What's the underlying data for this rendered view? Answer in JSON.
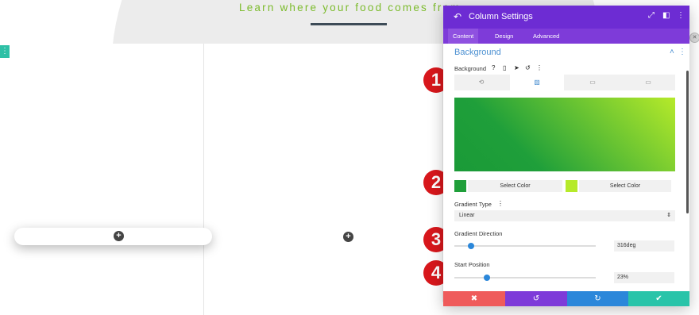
{
  "page": {
    "headline": "Learn where your food comes from",
    "side_handle_icon": "⋮",
    "plus_glyph": "+"
  },
  "badges": [
    "1",
    "2",
    "3",
    "4"
  ],
  "panel": {
    "back_icon": "↶",
    "title": "Column Settings",
    "header_icons": [
      "⤢",
      "◧",
      "⋮"
    ],
    "tabs": [
      "Content",
      "Design",
      "Advanced"
    ],
    "active_tab": "Content",
    "section_title": "Background",
    "section_collapse_icon": "˄",
    "section_menu_icon": "⋮",
    "background_label": "Background",
    "background_icons": [
      "?",
      "▯",
      "➤",
      "↺",
      "⋮"
    ],
    "bg_type_tabs": [
      "⟲",
      "▨",
      "▭",
      "▭"
    ],
    "bg_type_active": 1,
    "gradient": {
      "start_color": "#1f9f3a",
      "end_color": "#b6ea2a",
      "direction": "316deg"
    },
    "color1": {
      "swatch": "#1f9f3a",
      "label": "Select Color"
    },
    "color2": {
      "swatch": "#b6ea2a",
      "label": "Select Color"
    },
    "gradient_type_label": "Gradient Type",
    "gradient_type_help": "⋮",
    "gradient_type_value": "Linear",
    "select_arrow": "⇕",
    "direction_label": "Gradient Direction",
    "direction_value": "316deg",
    "direction_fraction": 0.12,
    "start_label": "Start Position",
    "start_value": "23%",
    "start_fraction": 0.23,
    "footer": {
      "cancel": "✖",
      "undo": "↺",
      "redo": "↻",
      "save": "✔",
      "colors": {
        "cancel": "#ef5b5b",
        "undo": "#7e3bd9",
        "redo": "#2b87da",
        "save": "#29c4a9"
      }
    }
  },
  "right_dot_icon": "✕"
}
